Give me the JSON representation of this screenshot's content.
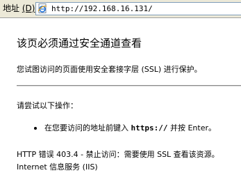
{
  "address_bar": {
    "label": "地址",
    "shortcut": "(D)",
    "url": "http://192.168.16.131/",
    "icon": "ie-page-icon"
  },
  "page": {
    "title": "该页必须通过安全通道查看",
    "subtitle": "您试图访问的页面使用安全套接字层 (SSL) 进行保护。",
    "try_heading": "请尝试以下操作：",
    "bullet_before": "在您要访问的地址前键入 ",
    "bullet_emphasis": "https://",
    "bullet_after": " 并按 Enter。",
    "error_text": "HTTP 错误 403.4 - 禁止访问：需要使用 SSL 查看该资源。",
    "server_text": "Internet 信息服务 (IIS)"
  }
}
